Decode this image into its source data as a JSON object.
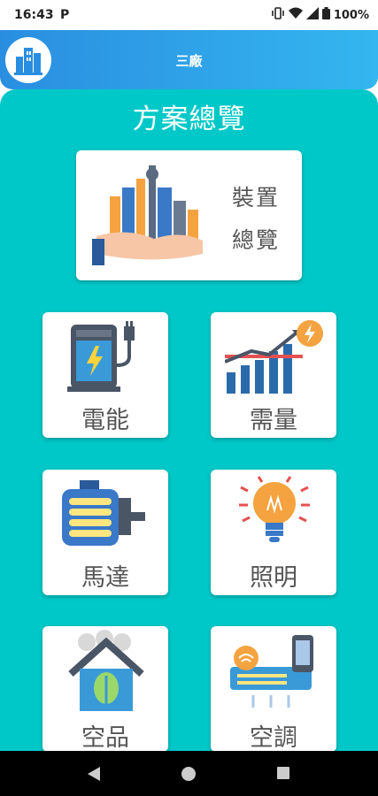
{
  "status_bar": {
    "time": "16:43",
    "notification_icon": "P",
    "battery": "100%",
    "icons": [
      "vibrate-icon",
      "wifi-icon",
      "signal-icon",
      "battery-icon"
    ]
  },
  "header": {
    "title": "三廠",
    "logo_icon": "building-logo-icon"
  },
  "main": {
    "title": "方案總覽",
    "overview_card": {
      "line1": "裝置",
      "line2": "總覽",
      "icon": "city-in-hand-icon"
    },
    "tiles": [
      {
        "label": "電能",
        "icon": "ev-charger-icon"
      },
      {
        "label": "需量",
        "icon": "demand-chart-icon"
      },
      {
        "label": "馬達",
        "icon": "motor-icon"
      },
      {
        "label": "照明",
        "icon": "light-bulb-icon"
      },
      {
        "label": "空品",
        "icon": "air-quality-house-icon"
      },
      {
        "label": "空調",
        "icon": "air-conditioner-icon"
      }
    ]
  },
  "nav": {
    "back": "back-icon",
    "home": "home-icon",
    "recents": "recents-icon"
  },
  "colors": {
    "header_start": "#2a8ee0",
    "header_end": "#34b6f0",
    "panel": "#00c8c8",
    "card": "#ffffff"
  }
}
